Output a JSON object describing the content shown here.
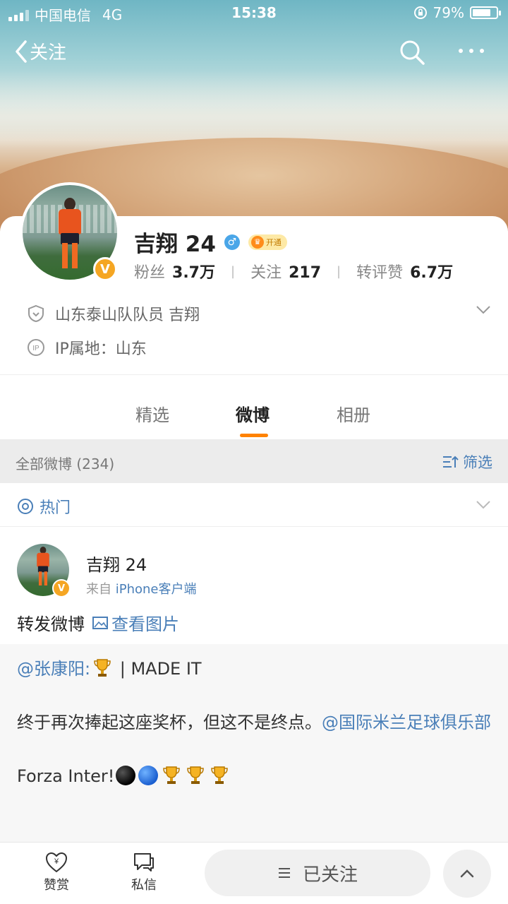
{
  "status": {
    "carrier": "中国电信",
    "network": "4G",
    "time": "15:38",
    "battery": "79%",
    "battery_level": 0.79
  },
  "nav": {
    "back_label": "关注",
    "search_icon": "search-icon",
    "more_icon": "more-icon"
  },
  "profile": {
    "name": "吉翔 24",
    "vip_label": "开通",
    "stats": [
      {
        "label": "粉丝",
        "value": "3.7万"
      },
      {
        "label": "关注",
        "value": "217"
      },
      {
        "label": "转评赞",
        "value": "6.7万"
      }
    ],
    "verified_info": "山东泰山队队员 吉翔",
    "ip_location": "IP属地：山东"
  },
  "tabs": [
    {
      "label": "精选"
    },
    {
      "label": "微博"
    },
    {
      "label": "相册"
    }
  ],
  "section": {
    "all_posts": "全部微博 (234)",
    "filter": "筛选"
  },
  "hot": {
    "label": "热门"
  },
  "post": {
    "author": "吉翔 24",
    "source_prefix": "来自",
    "source_device": "iPhone客户端",
    "text": "转发微博",
    "view_images": "查看图片",
    "repost": {
      "mention": "@张康阳:",
      "line1_after": " | MADE IT",
      "line2": "终于再次捧起这座奖杯，但这不是终点。",
      "line2_mention": "@国际米兰足球俱乐部",
      "line3": "Forza Inter!"
    }
  },
  "bottom": {
    "reward": "赞赏",
    "message": "私信",
    "follow_state": "已关注"
  },
  "colors": {
    "accent": "#ff8200",
    "link": "#4a7fb8",
    "verified": "#f5a623"
  }
}
